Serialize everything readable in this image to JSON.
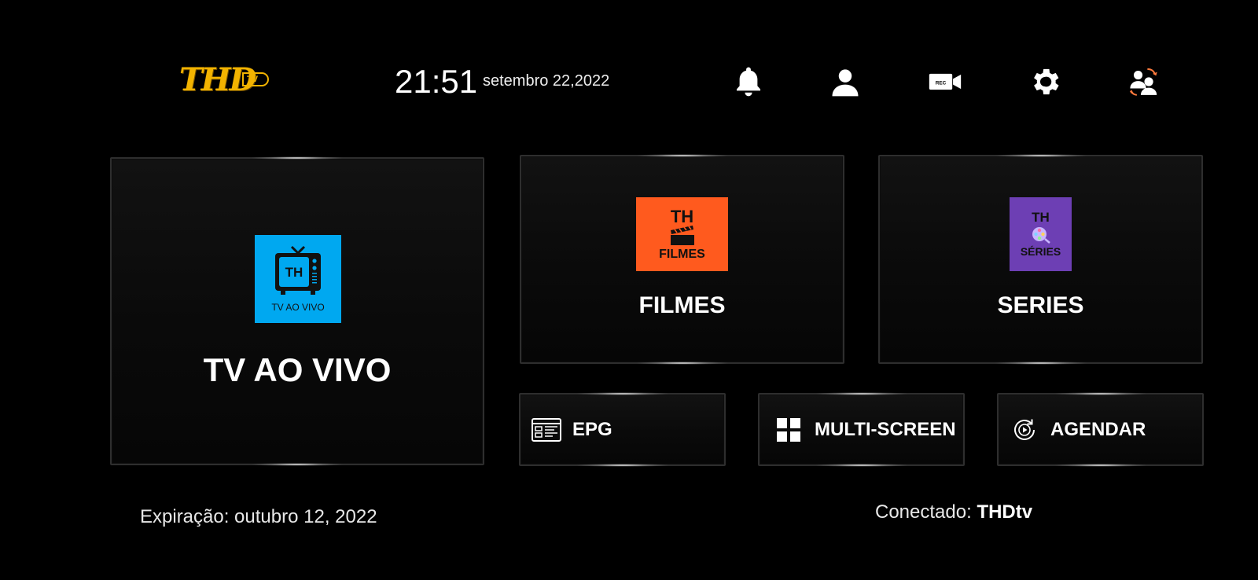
{
  "header": {
    "logo_text": "THD",
    "logo_sub": "TV",
    "time": "21:51",
    "date": "setembro 22,2022",
    "icons": [
      "bell-icon",
      "user-icon",
      "rec-camera-icon",
      "gear-icon",
      "switch-user-icon"
    ],
    "rec_label": "REC"
  },
  "tiles": {
    "tv": {
      "label": "TV AO VIVO",
      "thumb_title": "TH",
      "thumb_caption": "TV AO VIVO",
      "thumb_color": "#00a8f0"
    },
    "filmes": {
      "label": "FILMES",
      "thumb_title": "TH",
      "thumb_caption": "FILMES",
      "thumb_color": "#ff5a1e"
    },
    "series": {
      "label": "SERIES",
      "thumb_title": "TH",
      "thumb_caption": "SÉRIES",
      "thumb_color": "#6d3fb4"
    },
    "epg": {
      "label": "EPG"
    },
    "multi": {
      "label": "MULTI-SCREEN"
    },
    "agendar": {
      "label": "AGENDAR"
    }
  },
  "footer": {
    "expiration": "Expiração: outubro 12, 2022",
    "connected_label": "Conectado:",
    "connected_name": "THDtv"
  },
  "colors": {
    "logo": "#f2b300",
    "switch_arrows": "#ff7a3d",
    "background": "#000000"
  }
}
